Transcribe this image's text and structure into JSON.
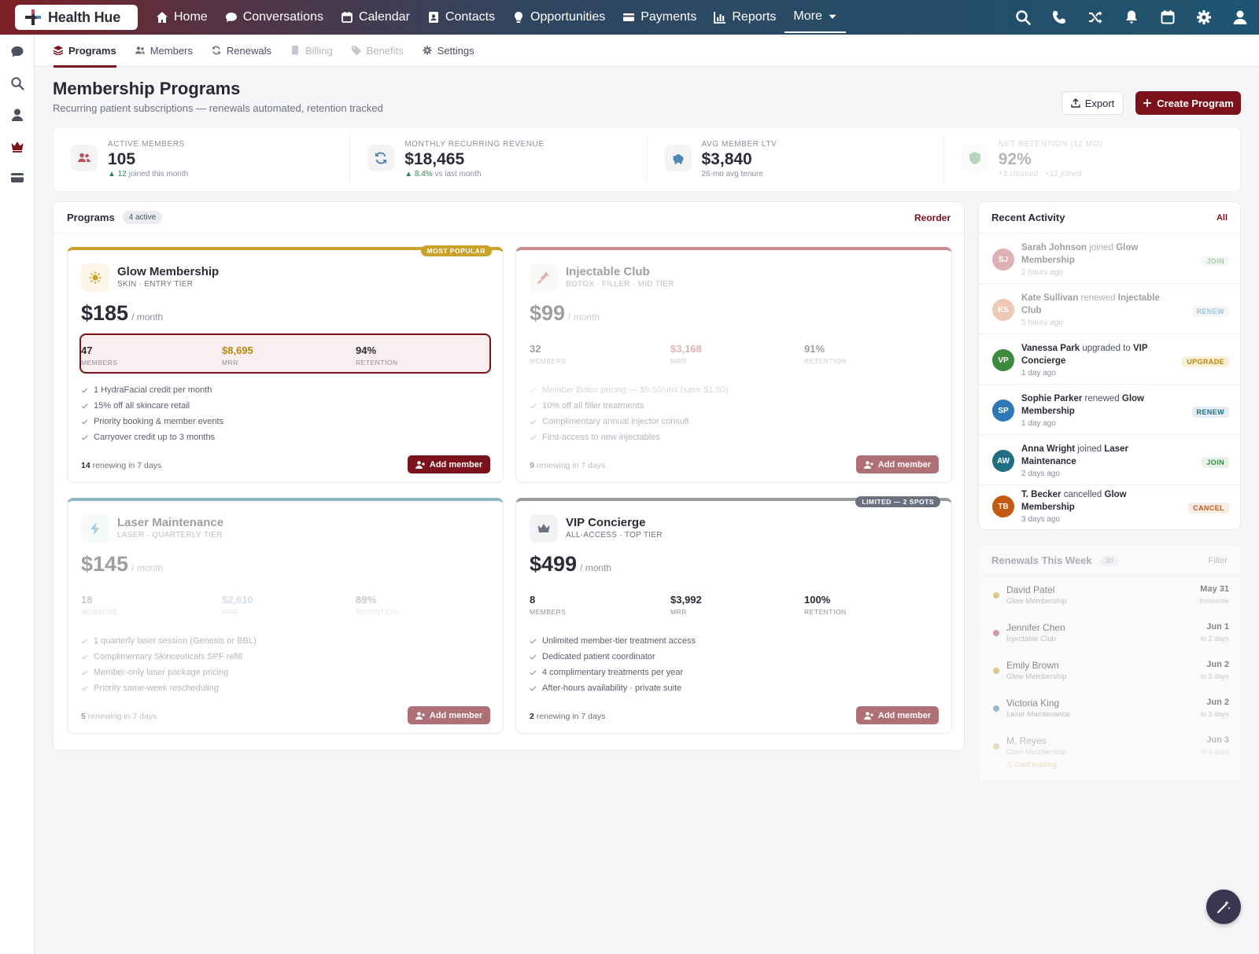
{
  "brand": {
    "name": "Health Hue"
  },
  "nav": {
    "items": [
      {
        "label": "Home",
        "icon": "home-icon"
      },
      {
        "label": "Conversations",
        "icon": "chat-icon"
      },
      {
        "label": "Calendar",
        "icon": "calendar-icon"
      },
      {
        "label": "Contacts",
        "icon": "contact-card-icon"
      },
      {
        "label": "Opportunities",
        "icon": "lightbulb-icon"
      },
      {
        "label": "Payments",
        "icon": "credit-card-icon"
      },
      {
        "label": "Reports",
        "icon": "bar-chart-icon"
      },
      {
        "label": "More",
        "icon": "caret-down-icon"
      }
    ],
    "right_icons": [
      "search-icon",
      "phone-icon",
      "shuffle-icon",
      "bell-icon",
      "calendar-icon",
      "gear-icon",
      "user-icon"
    ]
  },
  "rail": {
    "icons": [
      "chat-icon",
      "search-icon",
      "user-icon",
      "crown-icon",
      "credit-card-icon"
    ]
  },
  "subnav": {
    "tabs": [
      {
        "label": "Programs",
        "icon": "layers-icon",
        "state": "active"
      },
      {
        "label": "Members",
        "icon": "users-icon",
        "state": "normal"
      },
      {
        "label": "Renewals",
        "icon": "refresh-icon",
        "state": "normal"
      },
      {
        "label": "Billing",
        "icon": "receipt-icon",
        "state": "disabled"
      },
      {
        "label": "Benefits",
        "icon": "tag-icon",
        "state": "disabled"
      },
      {
        "label": "Settings",
        "icon": "gear-icon",
        "state": "normal"
      }
    ]
  },
  "header": {
    "title": "Membership Programs",
    "subtitle": "Recurring patient subscriptions — renewals automated, retention tracked",
    "export_label": "Export",
    "create_label": "Create Program"
  },
  "stats": [
    {
      "label": "ACTIVE MEMBERS",
      "value": "105",
      "delta": "▲ 12",
      "note": "joined this month",
      "icon": "users-icon"
    },
    {
      "label": "MONTHLY RECURRING REVENUE",
      "value": "$18,465",
      "delta": "▲ 8.4%",
      "note": "vs last month",
      "icon": "refresh-icon"
    },
    {
      "label": "AVG MEMBER LTV",
      "value": "$3,840",
      "delta": "",
      "note": "26-mo avg tenure",
      "icon": "piggy-bank-icon"
    },
    {
      "label": "NET RETENTION (12 MO)",
      "value": "92%",
      "delta": "",
      "note": "+3 churned · +12 joined",
      "icon": "shield-icon"
    }
  ],
  "programs": {
    "title": "Programs",
    "badge": "4 active",
    "reorder_label": "Reorder",
    "cards": [
      {
        "name": "Glow Membership",
        "tier": "SKIN · ENTRY TIER",
        "price": "$185",
        "period": "/ month",
        "ribbon": "MOST POPULAR",
        "metrics": [
          {
            "value": "47",
            "label": "MEMBERS"
          },
          {
            "value": "$8,695",
            "label": "MRR"
          },
          {
            "value": "94%",
            "label": "RETENTION"
          }
        ],
        "perks": [
          "1 HydraFacial credit per month",
          "15% off all skincare retail",
          "Priority booking & member events",
          "Carryover credit up to 3 months"
        ],
        "renewing_count": "14",
        "renewing_text": "renewing in 7 days",
        "add_label": "Add member",
        "accent": "#c9a227",
        "icon": "sun-icon"
      },
      {
        "name": "Injectable Club",
        "tier": "BOTOX · FILLER · MID TIER",
        "price": "$99",
        "period": "/ month",
        "ribbon": "",
        "metrics": [
          {
            "value": "32",
            "label": "MEMBERS"
          },
          {
            "value": "$3,168",
            "label": "MRR"
          },
          {
            "value": "91%",
            "label": "RETENTION"
          }
        ],
        "perks": [
          "Member Botox pricing — $9.50/unit (save $1.50)",
          "10% off all filler treatments",
          "Complimentary annual injector consult",
          "First-access to new injectables"
        ],
        "renewing_count": "9",
        "renewing_text": "renewing in 7 days",
        "add_label": "Add member",
        "accent": "#c98c8f",
        "icon": "syringe-icon"
      },
      {
        "name": "Laser Maintenance",
        "tier": "LASER · QUARTERLY TIER",
        "price": "$145",
        "period": "/ month",
        "ribbon": "",
        "metrics": [
          {
            "value": "18",
            "label": "MEMBERS"
          },
          {
            "value": "$2,610",
            "label": "MRR"
          },
          {
            "value": "89%",
            "label": "RETENTION"
          }
        ],
        "perks": [
          "1 quarterly laser session (Genesis or BBL)",
          "Complimentary Skinceuticals SPF refill",
          "Member-only laser package pricing",
          "Priority same-week rescheduling"
        ],
        "renewing_count": "5",
        "renewing_text": "renewing in 7 days",
        "add_label": "Add member",
        "accent": "#8fb6c9",
        "icon": "bolt-icon"
      },
      {
        "name": "VIP Concierge",
        "tier": "ALL-ACCESS · TOP TIER",
        "price": "$499",
        "period": "/ month",
        "ribbon": "LIMITED — 2 SPOTS",
        "metrics": [
          {
            "value": "8",
            "label": "MEMBERS"
          },
          {
            "value": "$3,992",
            "label": "MRR"
          },
          {
            "value": "100%",
            "label": "RETENTION"
          }
        ],
        "perks": [
          "Unlimited member-tier treatment access",
          "Dedicated patient coordinator",
          "4 complimentary treatments per year",
          "After-hours availability · private suite"
        ],
        "renewing_count": "2",
        "renewing_text": "renewing in 7 days",
        "add_label": "Add member",
        "accent": "#9a9a9e",
        "icon": "crown-icon"
      }
    ]
  },
  "activity": {
    "title": "Recent Activity",
    "all_label": "All",
    "items": [
      {
        "initials": "SJ",
        "name": "Sarah Johnson",
        "verb": "joined",
        "program": "Glow Membership",
        "time": "2 hours ago",
        "tag": "JOIN",
        "color": "#b8555c"
      },
      {
        "initials": "KS",
        "name": "Kate Sullivan",
        "verb": "renewed",
        "program": "Injectable Club",
        "time": "5 hours ago",
        "tag": "RENEW",
        "color": "#d88a5e"
      },
      {
        "initials": "VP",
        "name": "Vanessa Park",
        "verb": "upgraded to",
        "program": "VIP Concierge",
        "time": "1 day ago",
        "tag": "UPGRADE",
        "color": "#3c8a3e"
      },
      {
        "initials": "SP",
        "name": "Sophie Parker",
        "verb": "renewed",
        "program": "Glow Membership",
        "time": "1 day ago",
        "tag": "RENEW",
        "color": "#2f78b8"
      },
      {
        "initials": "AW",
        "name": "Anna Wright",
        "verb": "joined",
        "program": "Laser Maintenance",
        "time": "2 days ago",
        "tag": "JOIN",
        "color": "#1f6e82"
      },
      {
        "initials": "TB",
        "name": "T. Becker",
        "verb": "cancelled",
        "program": "Glow Membership",
        "time": "3 days ago",
        "tag": "CANCEL",
        "color": "#c25a12"
      }
    ]
  },
  "renewals": {
    "title": "Renewals This Week",
    "count": "30",
    "filter_label": "Filter",
    "items": [
      {
        "name": "David Patel",
        "program": "Glow Membership",
        "date": "May 31",
        "relative": "tomorrow",
        "dot": "#c9a227",
        "warning": ""
      },
      {
        "name": "Jennifer Chen",
        "program": "Injectable Club",
        "date": "Jun 1",
        "relative": "in 2 days",
        "dot": "#b8555c",
        "warning": ""
      },
      {
        "name": "Emily Brown",
        "program": "Glow Membership",
        "date": "Jun 2",
        "relative": "in 3 days",
        "dot": "#c9a227",
        "warning": ""
      },
      {
        "name": "Victoria King",
        "program": "Laser Maintenance",
        "date": "Jun 2",
        "relative": "in 3 days",
        "dot": "#4f86b0",
        "warning": ""
      },
      {
        "name": "M. Reyes",
        "program": "Glow Membership",
        "date": "Jun 3",
        "relative": "in 4 days",
        "dot": "#c9a227",
        "warning": "⚠ Card expiring"
      }
    ]
  }
}
